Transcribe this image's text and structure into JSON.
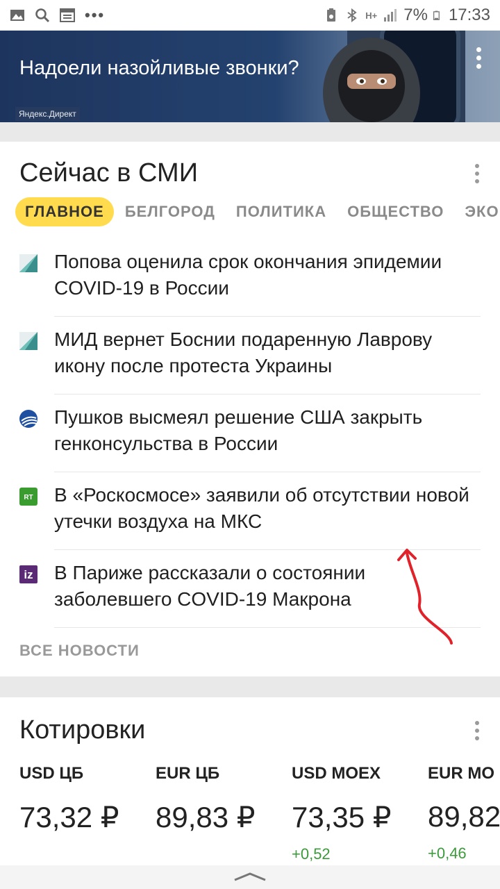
{
  "status_bar": {
    "battery": "7%",
    "time": "17:33",
    "network": "H+",
    "icons": [
      "gallery-icon",
      "search-icon",
      "news-icon",
      "more-dots-icon",
      "battery-saver-icon",
      "bluetooth-icon",
      "signal-icon",
      "battery-icon"
    ]
  },
  "banner": {
    "title": "Надоели назойливые звонки?",
    "source": "Яндекс.Директ"
  },
  "news": {
    "title": "Сейчас в СМИ",
    "tabs": [
      "ГЛАВНОЕ",
      "БЕЛГОРОД",
      "ПОЛИТИКА",
      "ОБЩЕСТВО",
      "ЭКО"
    ],
    "active_tab": "ГЛАВНОЕ",
    "items": [
      {
        "text": "Попова оценила срок окончания эпидемии COVID-19 в России",
        "icon": "source-triangle-icon"
      },
      {
        "text": "МИД вернет Боснии подаренную Лаврову икону после протеста Украины",
        "icon": "source-triangle-icon"
      },
      {
        "text": "Пушков высмеял решение США закрыть генконсульства в России",
        "icon": "source-globe-icon"
      },
      {
        "text": "В «Роскосмосе» заявили об отсутствии новой утечки воздуха на МКС",
        "icon": "rt-icon"
      },
      {
        "text": "В Париже рассказали о состоянии заболевшего COVID-19 Макрона",
        "icon": "iz-icon"
      }
    ],
    "all_news": "ВСЕ НОВОСТИ",
    "rt_label": "RT",
    "iz_label": "iz"
  },
  "quotes": {
    "title": "Котировки",
    "items": [
      {
        "name": "USD ЦБ",
        "value": "73,32 ₽",
        "change": ""
      },
      {
        "name": "EUR ЦБ",
        "value": "89,83 ₽",
        "change": ""
      },
      {
        "name": "USD MOEX",
        "value": "73,35 ₽",
        "change": "+0,52"
      },
      {
        "name": "EUR MO",
        "value": "89,82",
        "change": "+0,46"
      }
    ]
  },
  "colors": {
    "accent_tab": "#ffdb4d",
    "positive_change": "#3c9a3c",
    "annotation": "#e0232b"
  }
}
